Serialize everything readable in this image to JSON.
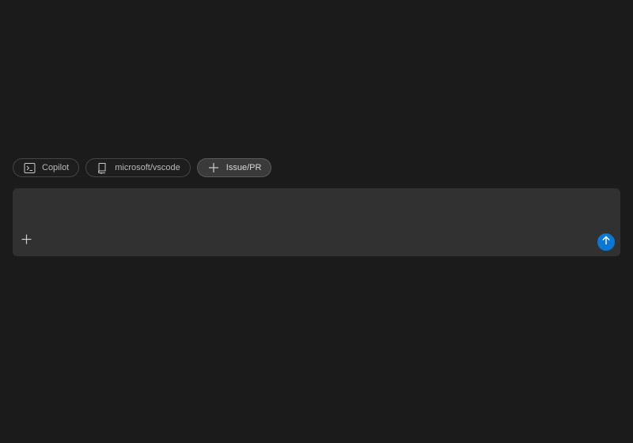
{
  "chips": [
    {
      "label": "Copilot",
      "icon": "terminal-icon",
      "active": false
    },
    {
      "label": "microsoft/vscode",
      "icon": "repo-icon",
      "active": false
    },
    {
      "label": "Issue/PR",
      "icon": "plus-icon",
      "active": true
    }
  ],
  "composer": {
    "value": "",
    "attach_icon": "plus-icon",
    "send_icon": "arrow-up-icon"
  },
  "colors": {
    "background": "#1b1b1b",
    "composer_bg": "#313131",
    "accent": "#0a78d4"
  }
}
